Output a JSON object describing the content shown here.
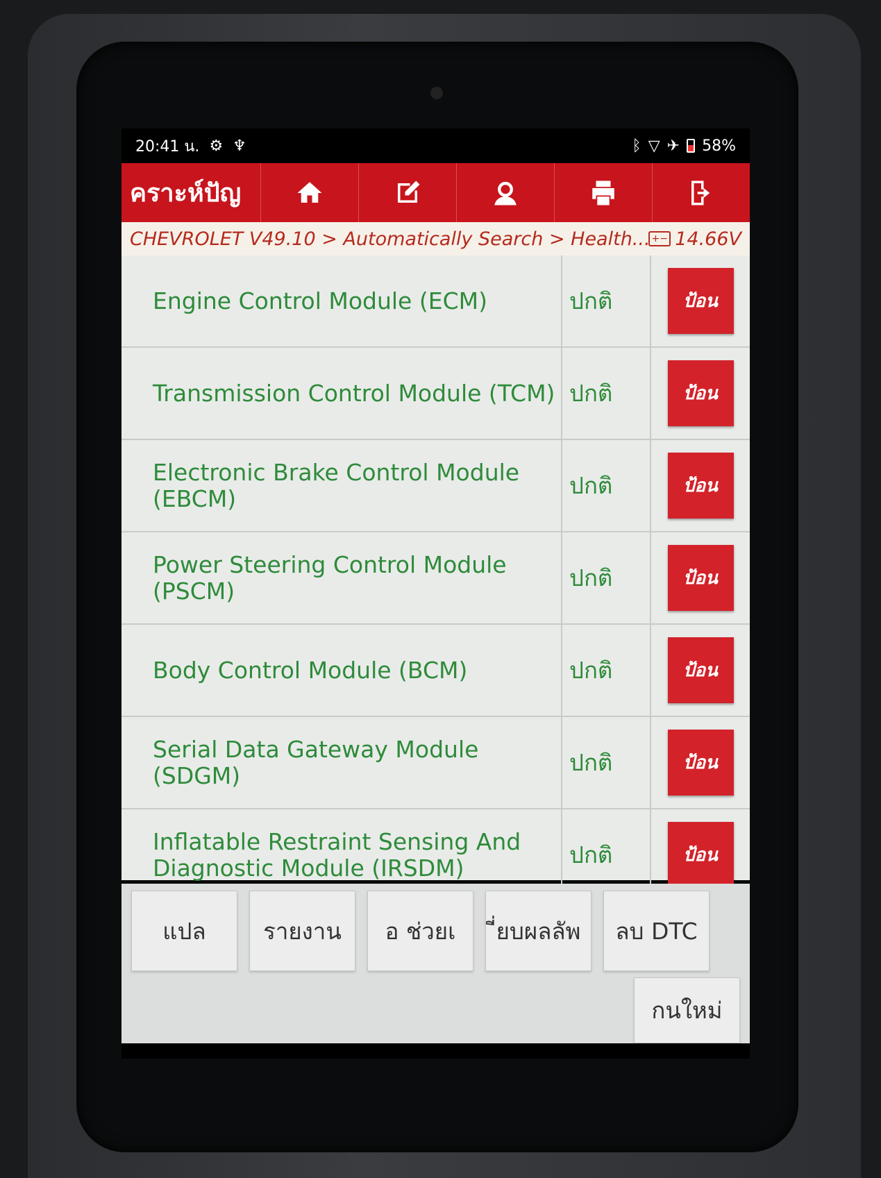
{
  "statusbar": {
    "time": "20:41 น.",
    "battery": "58%"
  },
  "appbar": {
    "title": "คราะห์ปัญ"
  },
  "breadcrumb": {
    "path": "CHEVROLET V49.10 > Automatically Search > Health...",
    "voltage": "14.66V"
  },
  "modules": [
    {
      "name": "Engine Control Module (ECM)",
      "status": "ปกติ",
      "action": "ป้อน"
    },
    {
      "name": "Transmission Control Module (TCM)",
      "status": "ปกติ",
      "action": "ป้อน"
    },
    {
      "name": "Electronic Brake Control Module (EBCM)",
      "status": "ปกติ",
      "action": "ป้อน"
    },
    {
      "name": "Power Steering Control Module (PSCM)",
      "status": "ปกติ",
      "action": "ป้อน"
    },
    {
      "name": "Body Control Module (BCM)",
      "status": "ปกติ",
      "action": "ป้อน"
    },
    {
      "name": "Serial Data Gateway Module (SDGM)",
      "status": "ปกติ",
      "action": "ป้อน"
    },
    {
      "name": "Inflatable Restraint Sensing And Diagnostic Module (IRSDM)",
      "status": "ปกติ",
      "action": "ป้อน"
    }
  ],
  "bottom": {
    "translate": "แปล",
    "report": "รายงาน",
    "help": "อ     ช่วยเ",
    "compare": "ี่ยบผลลัพ",
    "clear_dtc": "ลบ DTC",
    "new": "กนใหม่"
  },
  "colors": {
    "accent": "#c8141c",
    "module_text": "#2e8b3a",
    "enter_button": "#d3222a"
  }
}
